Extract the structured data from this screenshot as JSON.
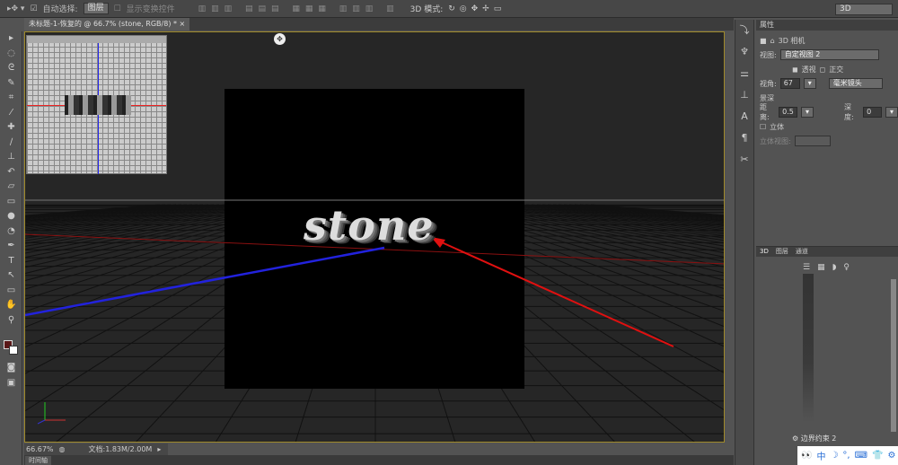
{
  "options_bar": {
    "auto_select_label": "自动选择:",
    "auto_select_checked": true,
    "auto_select_value": "图层",
    "show_transform_label": "显示变换控件",
    "mode_3d_label": "3D 模式:",
    "workspace": "3D"
  },
  "document_tab": {
    "title": "未标题-1-恢复的 @ 66.7% (stone, RGB/8) *",
    "close": "×"
  },
  "canvas": {
    "text": "stone"
  },
  "status": {
    "zoom": "66.67%",
    "doc_size": "文档:1.83M/2.00M"
  },
  "timeline_label": "时间轴",
  "properties": {
    "panel_title": "属性",
    "camera_label": "3D 相机",
    "view_label": "视图:",
    "view_value": "自定视图 2",
    "perspective": "透视",
    "ortho": "正交",
    "fov_label": "视角:",
    "fov_value": "67",
    "lens_value": "毫米镜头",
    "dof_label": "景深",
    "distance_label": "距离:",
    "distance_value": "0.5",
    "depth_label": "深度:",
    "depth_value": "0",
    "stereo_label": "立体",
    "stereo_view_label": "立体视图:"
  },
  "panel_3d": {
    "tabs": [
      "3D",
      "图层",
      "通道"
    ],
    "active_tab": 0,
    "item_label": "边界约束 2"
  },
  "ime": {
    "label": "中"
  }
}
